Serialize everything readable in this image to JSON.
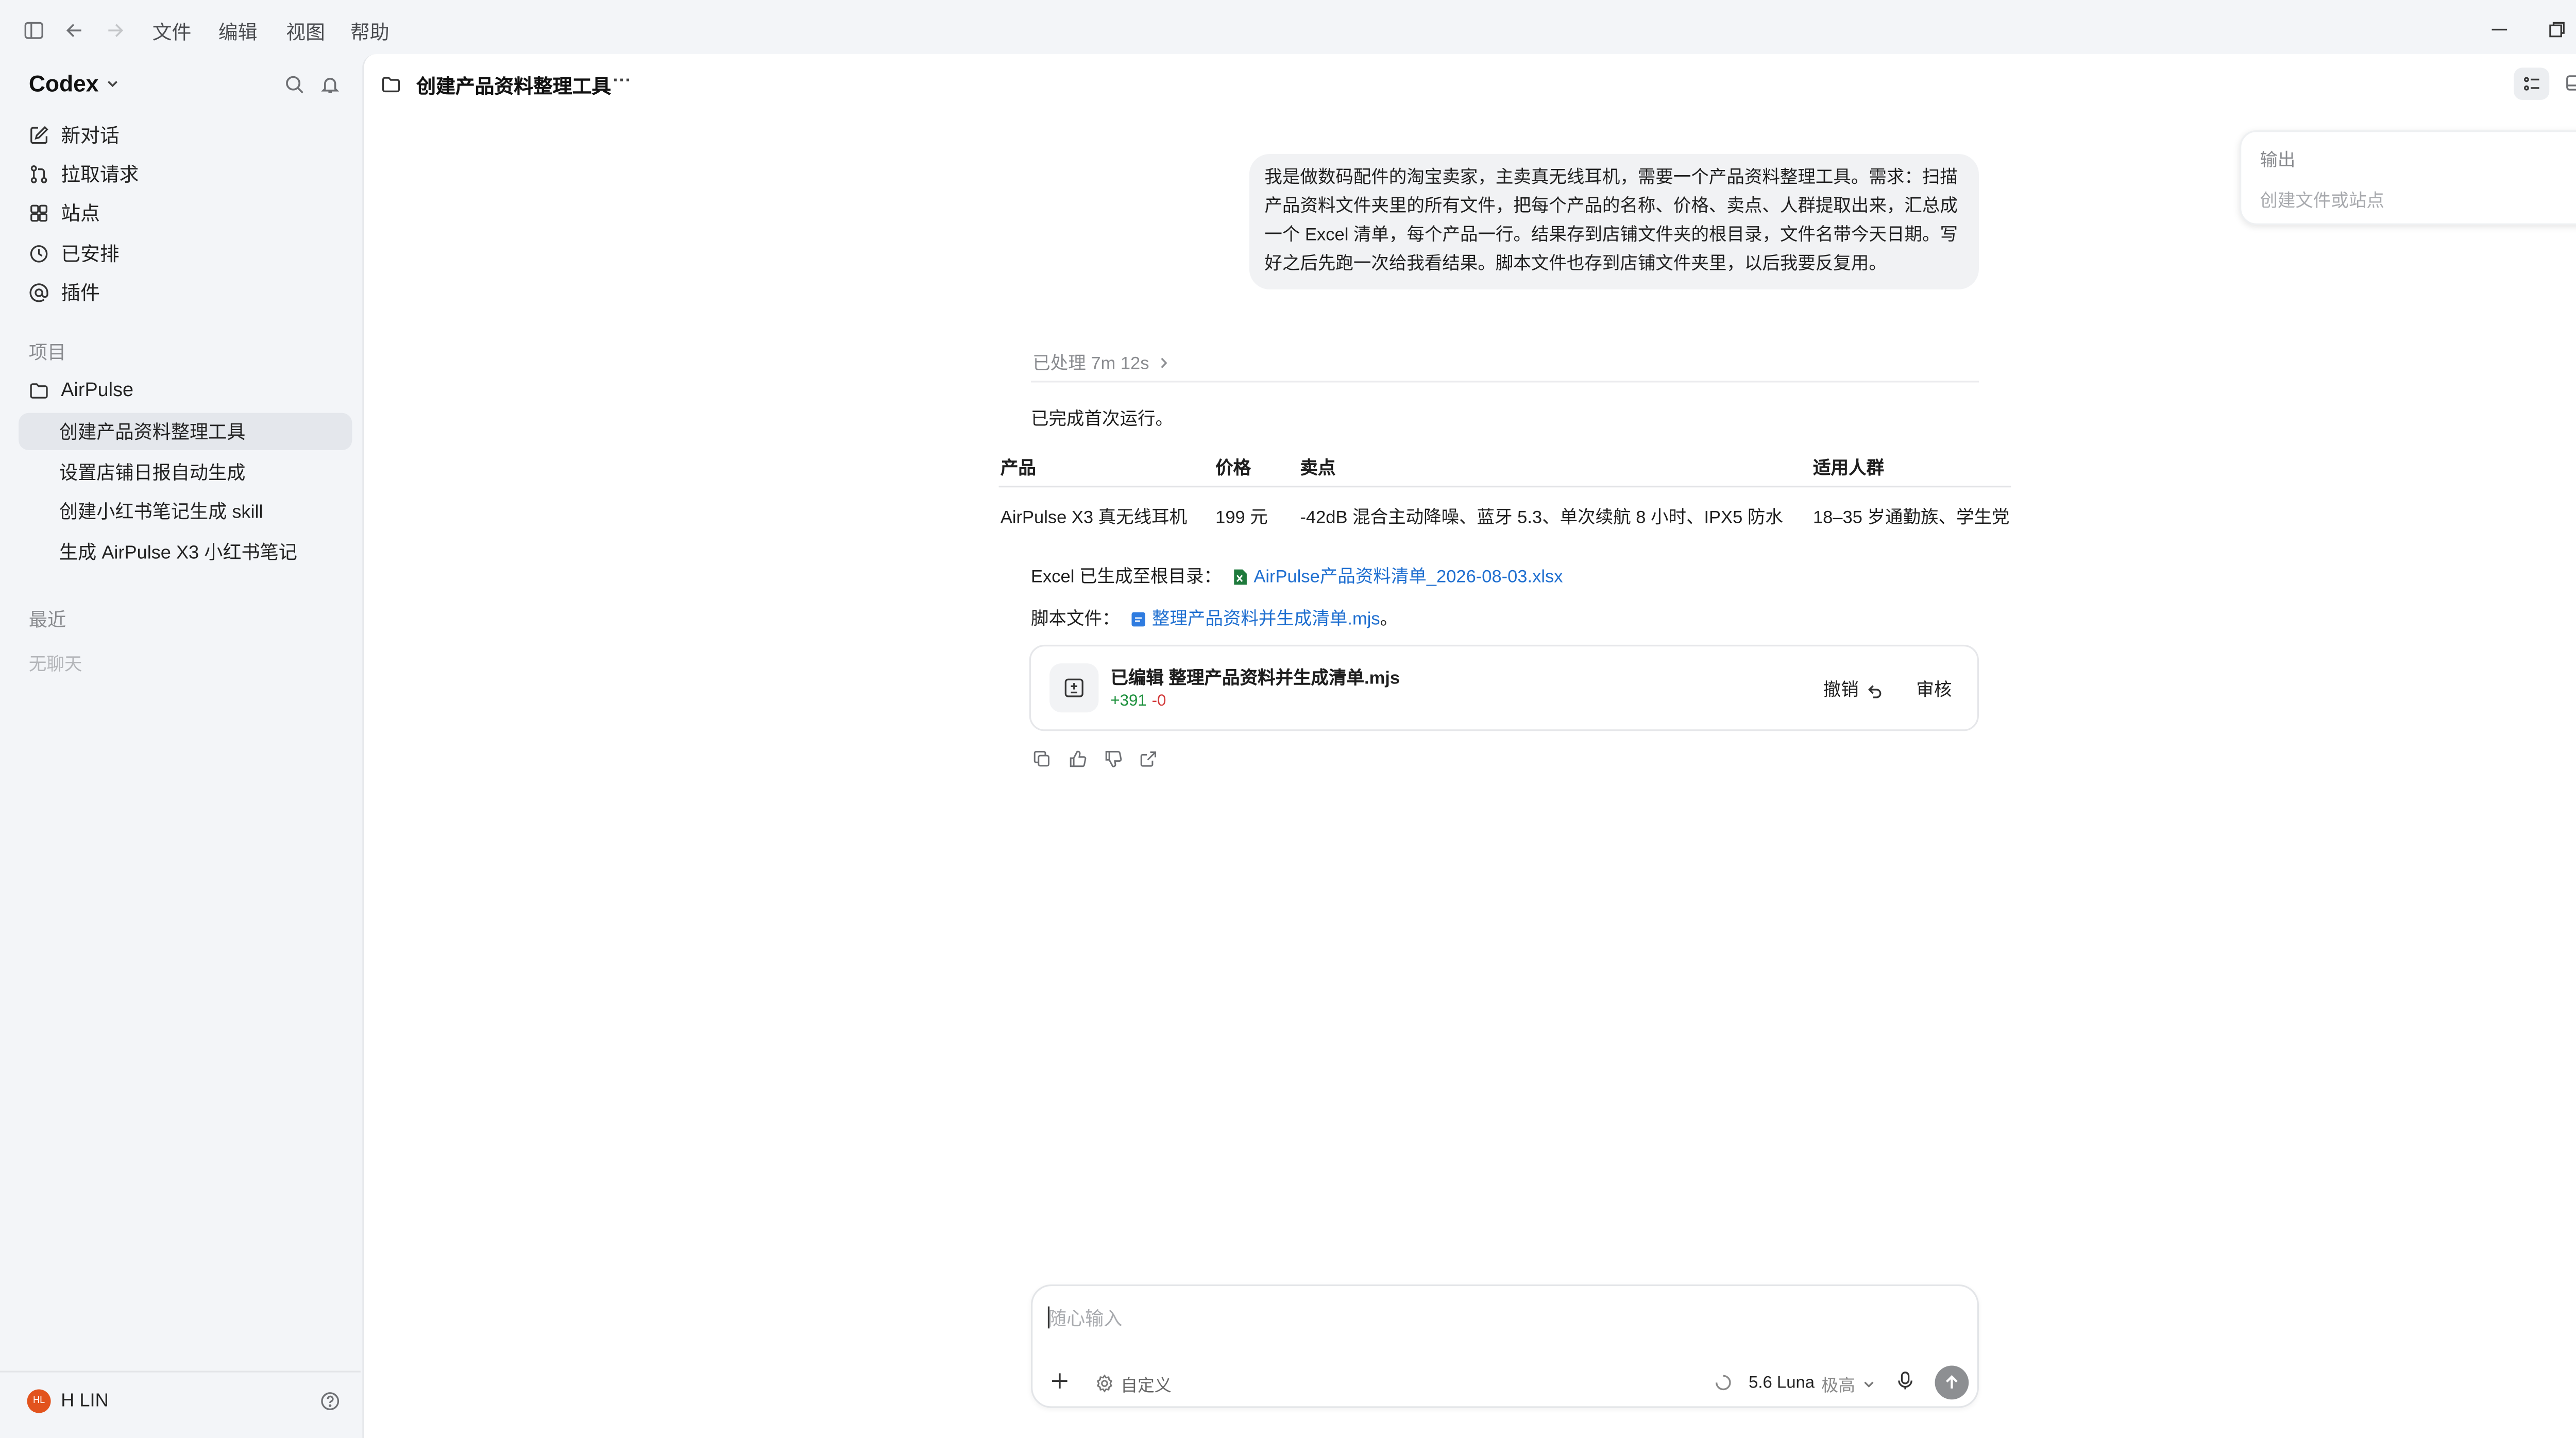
{
  "menubar": {
    "file": "文件",
    "edit": "编辑",
    "view": "视图",
    "help": "帮助"
  },
  "sidebar": {
    "app_name": "Codex",
    "nav": [
      {
        "label": "新对话",
        "icon": "new-chat-icon"
      },
      {
        "label": "拉取请求",
        "icon": "pull-request-icon"
      },
      {
        "label": "站点",
        "icon": "sites-icon"
      },
      {
        "label": "已安排",
        "icon": "clock-icon"
      },
      {
        "label": "插件",
        "icon": "plugin-icon"
      }
    ],
    "projects_heading": "项目",
    "project_name": "AirPulse",
    "threads": [
      {
        "label": "创建产品资料整理工具",
        "active": true
      },
      {
        "label": "设置店铺日报自动生成",
        "active": false
      },
      {
        "label": "创建小红书笔记生成 skill",
        "active": false
      },
      {
        "label": "生成 AirPulse X3 小红书笔记",
        "active": false
      }
    ],
    "recent_heading": "最近",
    "no_chats": "无聊天",
    "user": {
      "initials": "HL",
      "name": "H LIN",
      "avatar_color": "#e2531d"
    }
  },
  "header": {
    "title": "创建产品资料整理工具",
    "more": "···"
  },
  "output_panel": {
    "title": "输出",
    "subtitle": "创建文件或站点"
  },
  "conversation": {
    "user_message": "我是做数码配件的淘宝卖家，主卖真无线耳机，需要一个产品资料整理工具。需求：扫描产品资料文件夹里的所有文件，把每个产品的名称、价格、卖点、人群提取出来，汇总成一个 Excel 清单，每个产品一行。结果存到店铺文件夹的根目录，文件名带今天日期。写好之后先跑一次给我看结果。脚本文件也存到店铺文件夹里，以后我要反复用。",
    "processed": "已处理 7m 12s",
    "first_run": "已完成首次运行。",
    "table": {
      "headers": [
        "产品",
        "价格",
        "卖点",
        "适用人群"
      ],
      "rows": [
        [
          "AirPulse X3 真无线耳机",
          "199 元",
          "-42dB 混合主动降噪、蓝牙 5.3、单次续航 8 小时、IPX5 防水",
          "18–35 岁通勤族、学生党"
        ]
      ]
    },
    "excel_label": "Excel 已生成至根目录：",
    "excel_file": "AirPulse产品资料清单_2026-08-03.xlsx",
    "script_label": "脚本文件：",
    "script_file": "整理产品资料并生成清单.mjs",
    "script_suffix": "。",
    "edit_card": {
      "title": "已编辑 整理产品资料并生成清单.mjs",
      "added": "+391",
      "removed": "-0",
      "undo": "撤销",
      "review": "审核"
    }
  },
  "composer": {
    "placeholder": "随心输入",
    "custom": "自定义",
    "model": "5.6 Luna",
    "effort": "极高"
  },
  "colors": {
    "accent_link": "#1f6fd0",
    "added_green": "#1a8f3a",
    "removed_red": "#d23b3b",
    "excel_green": "#1e7a3c"
  }
}
